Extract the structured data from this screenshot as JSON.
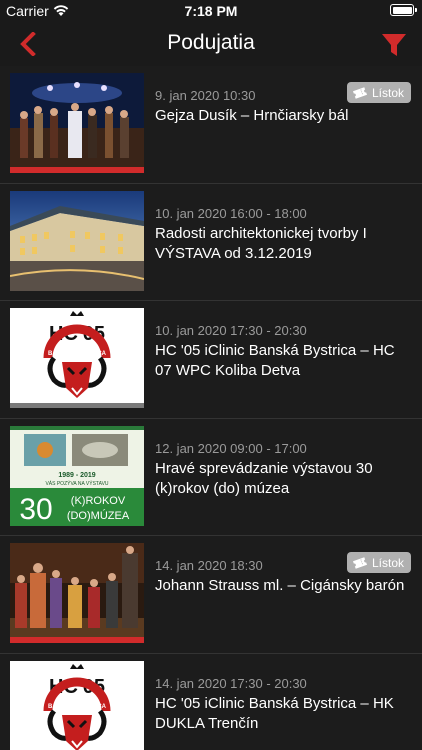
{
  "status": {
    "carrier": "Carrier",
    "time": "7:18 PM"
  },
  "nav": {
    "title": "Podujatia",
    "back_icon": "chevron-left-icon",
    "filter_icon": "filter-icon",
    "accent": "#d12b2b"
  },
  "events": [
    {
      "date": "9. jan 2020 10:30",
      "name": "Gejza Dusík – Hrnčiarsky bál",
      "ticket": "Lístok"
    },
    {
      "date": "10. jan 2020 16:00 - 18:00",
      "name": "Radosti architektonickej tvorby I VÝSTAVA od 3.12.2019"
    },
    {
      "date": "10. jan 2020 17:30 - 20:30",
      "name": "HC '05 iClinic Banská Bystrica – HC 07 WPC Koliba Detva"
    },
    {
      "date": "12. jan 2020 09:00 - 17:00",
      "name": "Hravé sprevádzanie výstavou 30 (k)rokov (do) múzea"
    },
    {
      "date": "14. jan 2020 18:30",
      "name": "Johann Strauss ml. – Cigánsky barón",
      "ticket": "Lístok"
    },
    {
      "date": "14. jan 2020 17:30 - 20:30",
      "name": "HC '05 iClinic Banská Bystrica – HK DUKLA Trenčín"
    }
  ],
  "logo": {
    "top": "HC'05",
    "ring": "BANSKÁ BYSTRICA"
  },
  "poster": {
    "years": "1989 - 2019",
    "tagline": "VÁS POZÝVA NA VÝSTAVU",
    "big": "30",
    "line1": "(K)ROKOV",
    "line2": "(DO)MÚZEA"
  }
}
